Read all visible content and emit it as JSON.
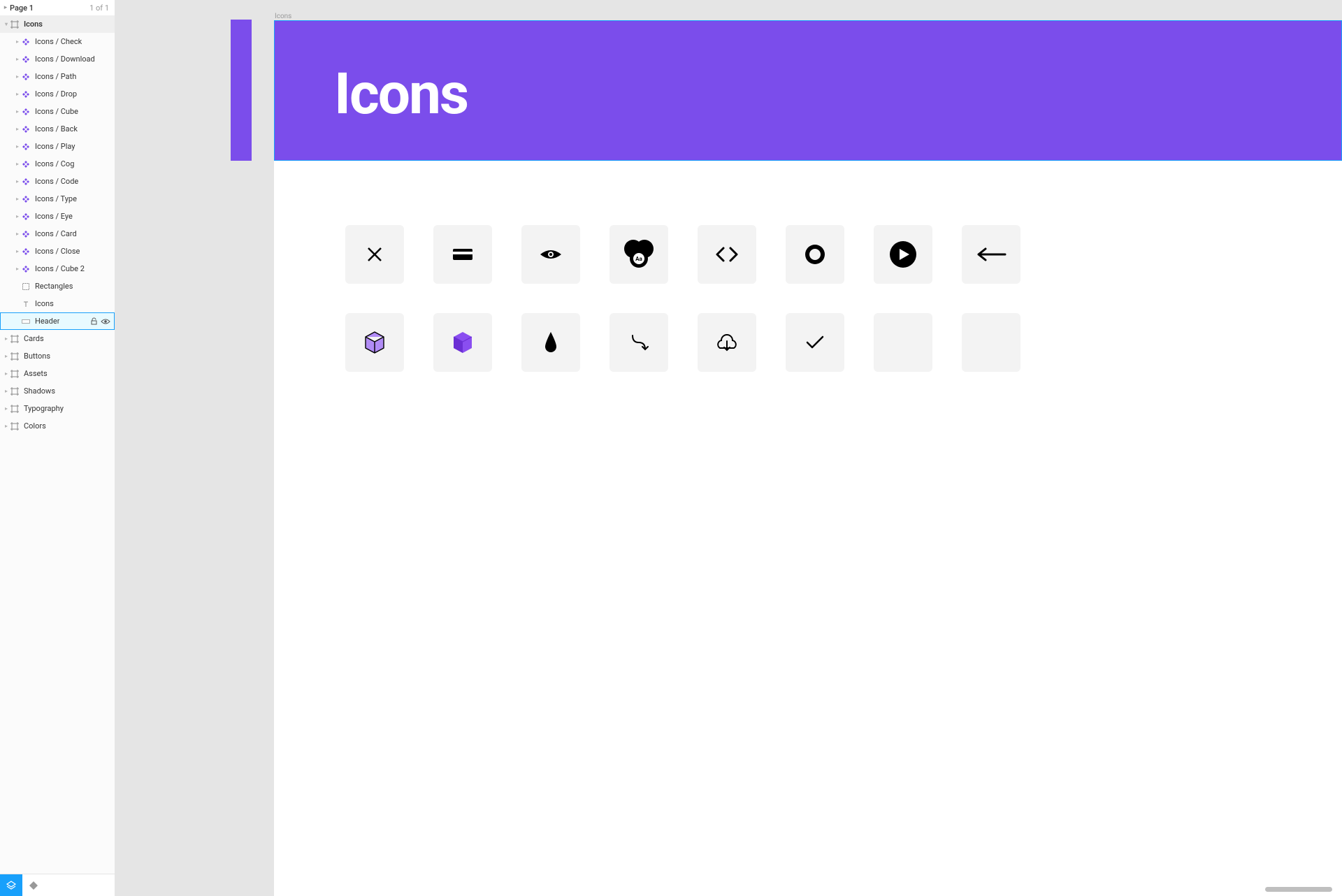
{
  "page": {
    "name": "Page 1",
    "count": "1 of 1"
  },
  "tree": [
    {
      "label": "Icons",
      "depth": 0,
      "icon": "frame",
      "state": "parent",
      "disc": "down"
    },
    {
      "label": "Icons / Check",
      "depth": 1,
      "icon": "comp",
      "disc": "right"
    },
    {
      "label": "Icons / Download",
      "depth": 1,
      "icon": "comp",
      "disc": "right"
    },
    {
      "label": "Icons / Path",
      "depth": 1,
      "icon": "comp",
      "disc": "right"
    },
    {
      "label": "Icons / Drop",
      "depth": 1,
      "icon": "comp",
      "disc": "right"
    },
    {
      "label": "Icons / Cube",
      "depth": 1,
      "icon": "comp",
      "disc": "right"
    },
    {
      "label": "Icons / Back",
      "depth": 1,
      "icon": "comp",
      "disc": "right"
    },
    {
      "label": "Icons / Play",
      "depth": 1,
      "icon": "comp",
      "disc": "right"
    },
    {
      "label": "Icons / Cog",
      "depth": 1,
      "icon": "comp",
      "disc": "right"
    },
    {
      "label": "Icons / Code",
      "depth": 1,
      "icon": "comp",
      "disc": "right"
    },
    {
      "label": "Icons / Type",
      "depth": 1,
      "icon": "comp",
      "disc": "right"
    },
    {
      "label": "Icons / Eye",
      "depth": 1,
      "icon": "comp",
      "disc": "right"
    },
    {
      "label": "Icons / Card",
      "depth": 1,
      "icon": "comp",
      "disc": "right"
    },
    {
      "label": "Icons / Close",
      "depth": 1,
      "icon": "comp",
      "disc": "right"
    },
    {
      "label": "Icons / Cube 2",
      "depth": 1,
      "icon": "comp",
      "disc": "right"
    },
    {
      "label": "Rectangles",
      "depth": 1,
      "icon": "group",
      "disc": ""
    },
    {
      "label": "Icons",
      "depth": 1,
      "icon": "text",
      "disc": ""
    },
    {
      "label": "Header",
      "depth": 1,
      "icon": "rect",
      "state": "sel",
      "disc": ""
    },
    {
      "label": "Cards",
      "depth": 0,
      "icon": "frame",
      "disc": "right"
    },
    {
      "label": "Buttons",
      "depth": 0,
      "icon": "frame",
      "disc": "right"
    },
    {
      "label": "Assets",
      "depth": 0,
      "icon": "frame",
      "disc": "right"
    },
    {
      "label": "Shadows",
      "depth": 0,
      "icon": "frame",
      "disc": "right"
    },
    {
      "label": "Typography",
      "depth": 0,
      "icon": "frame",
      "disc": "right"
    },
    {
      "label": "Colors",
      "depth": 0,
      "icon": "frame",
      "disc": "right"
    }
  ],
  "canvas": {
    "frame_label": "Icons",
    "header_title": "Icons",
    "cells": [
      "close",
      "card",
      "eye",
      "type",
      "code",
      "cog",
      "play",
      "back",
      "cube-outline",
      "cube-fill",
      "drop",
      "path",
      "download",
      "check",
      "empty",
      "empty"
    ]
  },
  "colors": {
    "accent": "#7b4deb",
    "select": "#18a0fb"
  }
}
